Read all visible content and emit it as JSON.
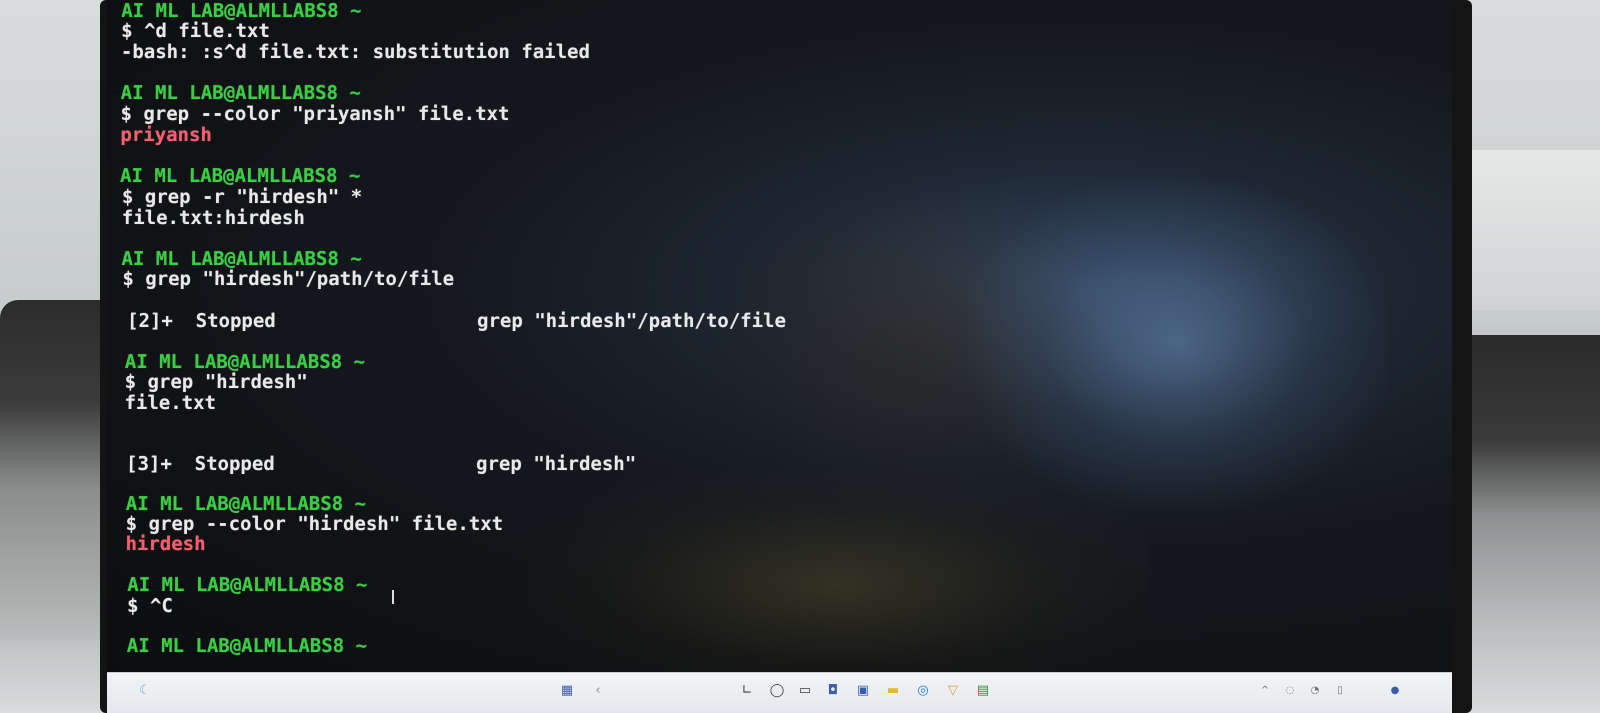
{
  "terminal": {
    "lines": [
      {
        "text": "AI ML LAB@ALMLLABS8 ~",
        "kind": "prompt"
      },
      {
        "text": "$ ^d file.txt",
        "kind": "cmd"
      },
      {
        "text": "-bash: :s^d file.txt: substitution failed",
        "kind": "out"
      },
      {
        "text": "AI ML LAB@ALMLLABS8 ~",
        "kind": "prompt"
      },
      {
        "text": "$ grep --color \"priyansh\" file.txt",
        "kind": "cmd"
      },
      {
        "text": "priyansh",
        "kind": "match"
      },
      {
        "text": "AI ML LAB@ALMLLABS8 ~",
        "kind": "prompt"
      },
      {
        "text": "$ grep -r \"hirdesh\" *",
        "kind": "cmd"
      },
      {
        "text": "file.txt:hirdesh",
        "kind": "out"
      },
      {
        "text": "AI ML LAB@ALMLLABS8 ~",
        "kind": "prompt"
      },
      {
        "text": "$ grep \"hirdesh\"/path/to/file",
        "kind": "cmd"
      },
      {
        "text": "",
        "kind": "job",
        "job": "[2]+  Stopped",
        "cmd": "grep \"hirdesh\"/path/to/file"
      },
      {
        "text": "AI ML LAB@ALMLLABS8 ~",
        "kind": "prompt"
      },
      {
        "text": "$ grep \"hirdesh\"",
        "kind": "cmd"
      },
      {
        "text": "file.txt",
        "kind": "out"
      },
      {
        "text": "",
        "kind": "job",
        "job": "[3]+  Stopped",
        "cmd": "grep \"hirdesh\""
      },
      {
        "text": "AI ML LAB@ALMLLABS8 ~",
        "kind": "prompt"
      },
      {
        "text": "$ grep --color \"hirdesh\" file.txt",
        "kind": "cmd"
      },
      {
        "text": "hirdesh",
        "kind": "match"
      },
      {
        "text": "AI ML LAB@ALMLLABS8 ~",
        "kind": "prompt"
      },
      {
        "text": "$ ^C",
        "kind": "cmd"
      },
      {
        "text": "AI ML LAB@ALMLLABS8 ~",
        "kind": "prompt"
      }
    ]
  },
  "colors": {
    "prompt": "#35d13f",
    "match": "#ff5c6e",
    "text": "#e9e9e9",
    "screen_bg": "#101215"
  },
  "taskbar": {
    "icons": [
      "start-icon",
      "search-icon",
      "task-view-icon",
      "widgets-icon",
      "chat-icon",
      "file-explorer-icon",
      "edge-icon",
      "store-icon",
      "terminal-icon"
    ]
  }
}
